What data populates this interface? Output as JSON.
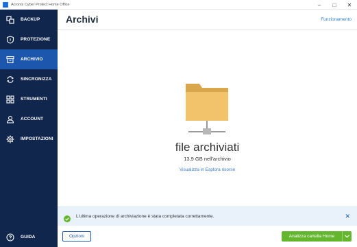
{
  "window": {
    "title": "Acronis Cyber Protect Home Office",
    "controls": {
      "minimize": "–",
      "maximize": "□",
      "close": "✕"
    }
  },
  "sidebar": {
    "items": [
      {
        "label": "BACKUP",
        "icon": "backup-icon"
      },
      {
        "label": "PROTEZIONE",
        "icon": "shield-icon"
      },
      {
        "label": "ARCHIVIO",
        "icon": "archive-box-icon",
        "active": true
      },
      {
        "label": "SINCRONIZZA",
        "icon": "sync-icon"
      },
      {
        "label": "STRUMENTI",
        "icon": "tools-grid-icon"
      },
      {
        "label": "ACCOUNT",
        "icon": "user-icon"
      },
      {
        "label": "IMPOSTAZIONI",
        "icon": "gear-icon"
      }
    ],
    "help_label": "GUIDA"
  },
  "header": {
    "title": "Archivi",
    "howto_link": "Funzionamento"
  },
  "content": {
    "archived_title": "file archiviati",
    "archived_size": "13,9 GB nell'archivio",
    "explorer_link": "Visualizza in Esplora risorse"
  },
  "notice": {
    "message": "L'ultima operazione di archiviazione è stata completata correttamente."
  },
  "footer": {
    "options_label": "Opzioni",
    "analyze_label": "Analizza cartella Home"
  },
  "colors": {
    "sidebar_bg": "#11264d",
    "active_item": "#1c56ad",
    "link": "#2e7bd6",
    "success_green": "#64b62f",
    "folder": "#f2c36b"
  }
}
